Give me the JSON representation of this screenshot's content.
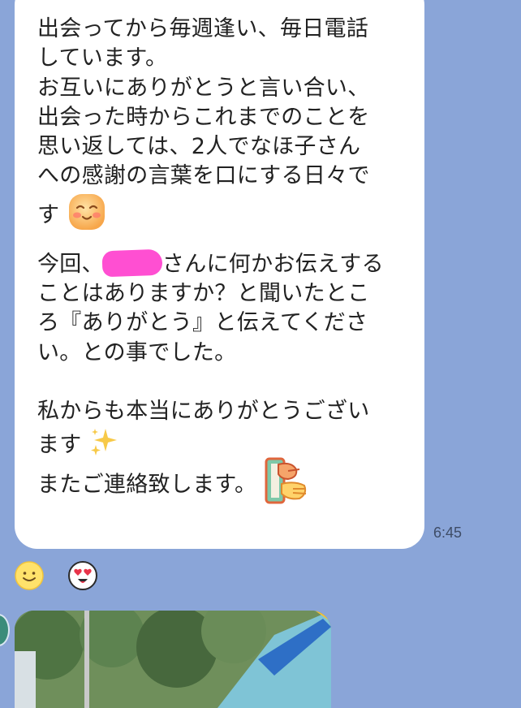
{
  "message": {
    "lines": [
      "出会ってから毎週逢い、毎日電話",
      "しています。",
      "お互いにありがとうと言い合い、",
      "出会った時からこれまでのことを",
      "思い返しては、2人でなほ子さん",
      "への感謝の言葉を口にする日々で",
      "す",
      "",
      "今回、",
      "さんに何かお伝えする",
      "ことはありますか？と聞いたとこ",
      "ろ『ありがとう』と伝えてくださ",
      "い。との事でした。",
      "",
      "私からも本当にありがとうござい",
      "ます",
      "またご連絡致します。"
    ],
    "time": "6:45"
  },
  "reactions": [
    {
      "icon": "smile-emoji-icon"
    },
    {
      "icon": "heart-eyes-emoji-icon"
    }
  ],
  "icons": {
    "blush": "blushing-face-emoji-icon",
    "sparkles": "sparkles-emoji-icon",
    "sticker": "bowing-person-sticker-icon",
    "redaction": "redacted-name-mark"
  },
  "colors": {
    "chat_background": "#8aa5d8",
    "bubble": "#ffffff",
    "text": "#222222",
    "redaction": "#ff4fd2"
  }
}
